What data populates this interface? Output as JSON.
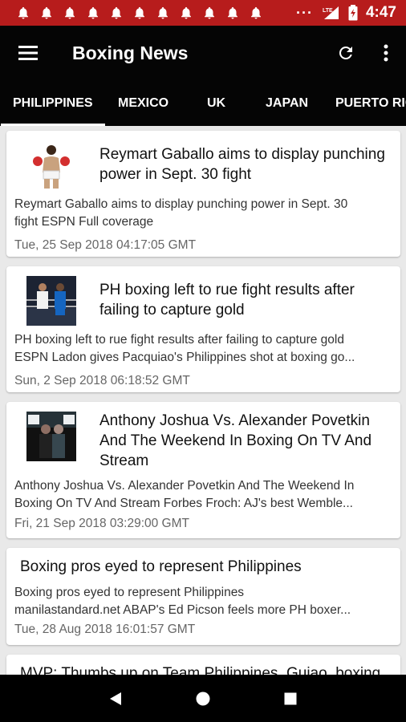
{
  "status_bar": {
    "notification_count": 11,
    "overflow": "···",
    "signal_label": "LTE",
    "time": "4:47",
    "color": "#b71c1c"
  },
  "app_bar": {
    "title": "Boxing News",
    "menu_icon": "hamburger-menu-icon",
    "refresh_icon": "refresh-icon",
    "more_icon": "more-vert-icon"
  },
  "tabs": [
    {
      "label": "PHILIPPINES",
      "active": true
    },
    {
      "label": "MEXICO",
      "active": false
    },
    {
      "label": "UK",
      "active": false
    },
    {
      "label": "JAPAN",
      "active": false
    },
    {
      "label": "PUERTO RICO",
      "active": false
    }
  ],
  "articles": [
    {
      "title": "Reymart Gaballo aims to display punching power in Sept. 30 fight",
      "desc_lines": [
        "Reymart Gaballo aims to display punching power in Sept. 30",
        "fight  ESPN  Full coverage"
      ],
      "date": "Tue, 25 Sep 2018 04:17:05 GMT",
      "thumbnail": "boxer-photo"
    },
    {
      "title": "PH boxing left to rue fight results after failing to capture gold",
      "desc_lines": [
        "PH boxing left to rue fight results after failing to capture gold",
        "ESPN  Ladon gives Pacquiao's Philippines shot at boxing go..."
      ],
      "date": "Sun, 2 Sep 2018 06:18:52 GMT",
      "thumbnail": "boxing-ring-photo"
    },
    {
      "title": "Anthony Joshua Vs. Alexander Povetkin And The Weekend In Boxing On TV And Stream",
      "desc_lines": [
        "Anthony Joshua Vs. Alexander Povetkin And The Weekend In",
        "Boxing On TV And Stream  Forbes  Froch: AJ's best Wemble..."
      ],
      "date": "Fri, 21 Sep 2018 03:29:00 GMT",
      "thumbnail": "press-conference-photo"
    },
    {
      "title": "Boxing pros eyed to represent Philippines",
      "desc_lines": [
        "Boxing pros eyed to represent Philippines",
        "manilastandard.net  ABAP's Ed Picson feels more PH boxer..."
      ],
      "date": "Tue, 28 Aug 2018 16:01:57 GMT",
      "thumbnail": ""
    },
    {
      "title": "MVP: Thumbs up on Team Philippines, Guiao, boxing",
      "desc_lines": [],
      "date": "",
      "thumbnail": ""
    }
  ],
  "nav_bar": {
    "back_icon": "back-triangle-icon",
    "home_icon": "home-circle-icon",
    "recents_icon": "recents-square-icon"
  }
}
